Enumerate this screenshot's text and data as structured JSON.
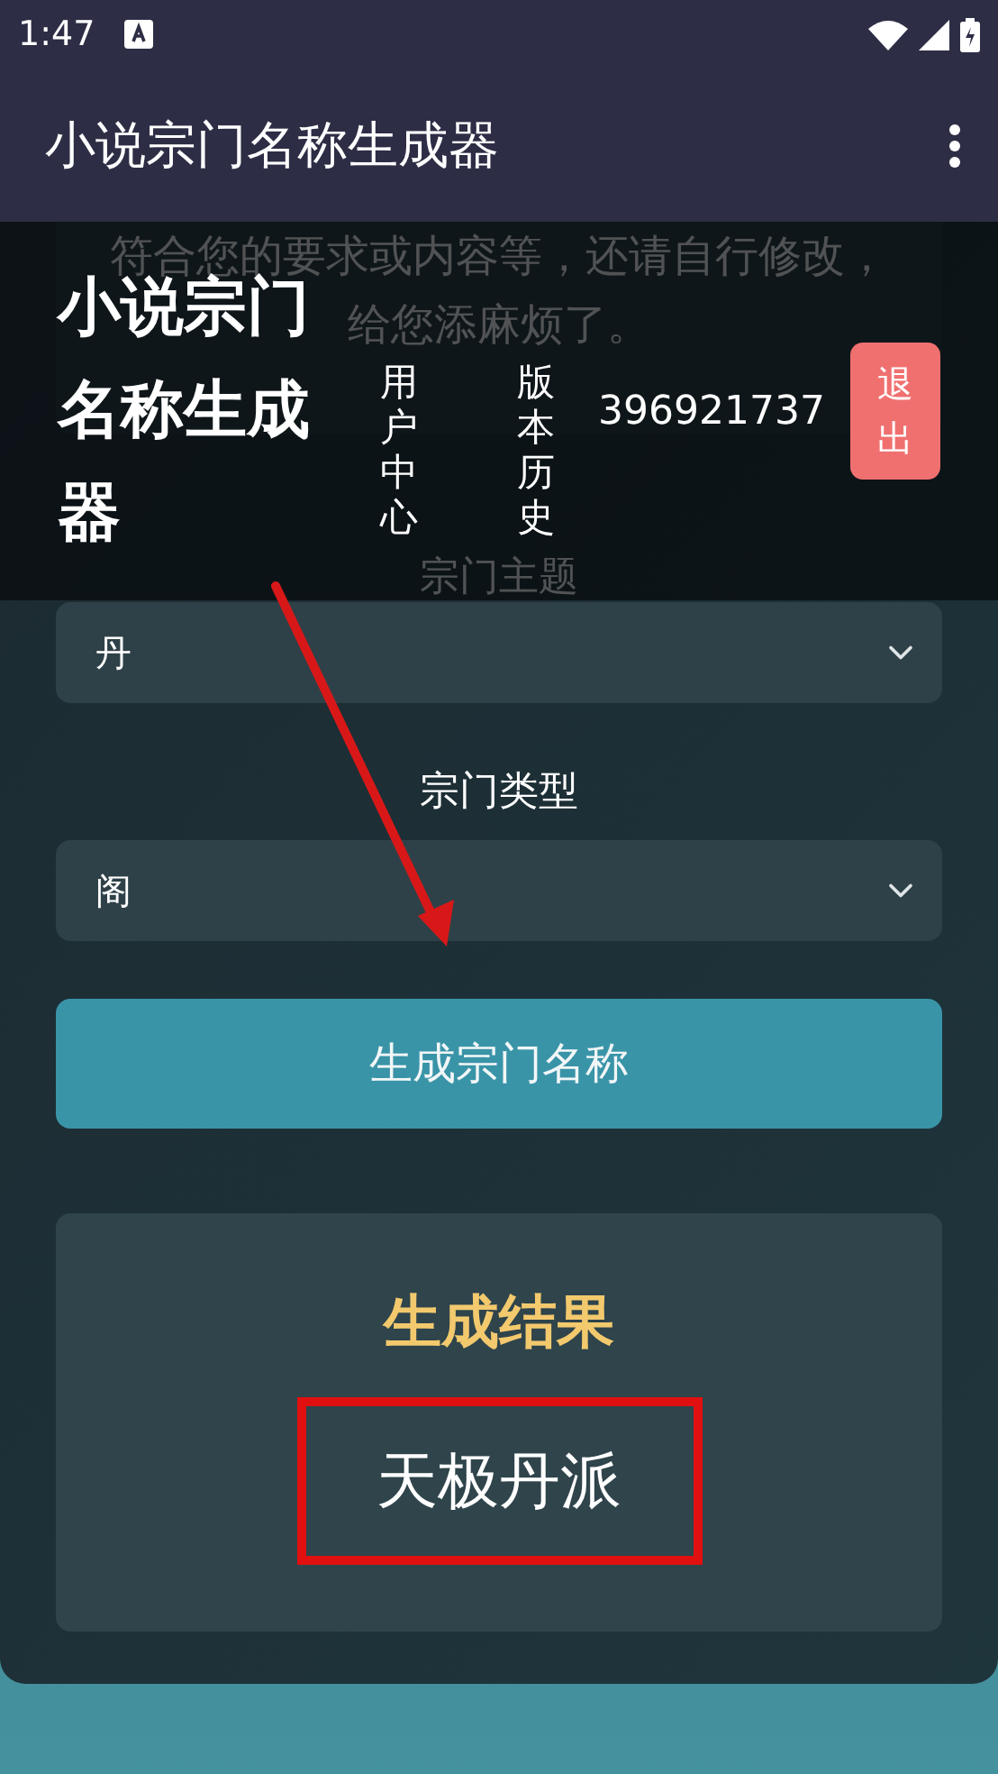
{
  "status_bar": {
    "time": "1:47"
  },
  "app_bar": {
    "title": "小说宗门名称生成器"
  },
  "notice": {
    "lines": [
      "符合您的要求或内容等，还请自行修改，",
      "给您添麻烦了。"
    ]
  },
  "form": {
    "fields": [
      {
        "label": "宗门主题",
        "value": "丹"
      },
      {
        "label": "宗门类型",
        "value": "阁"
      }
    ],
    "generate_button": "生成宗门名称"
  },
  "result": {
    "title": "生成结果",
    "value": "天极丹派"
  },
  "site_header": {
    "title": "小说宗门名称生成器",
    "nav": [
      "用户中心",
      "版本历史"
    ],
    "user_id": "396921737",
    "logout": "退出"
  }
}
